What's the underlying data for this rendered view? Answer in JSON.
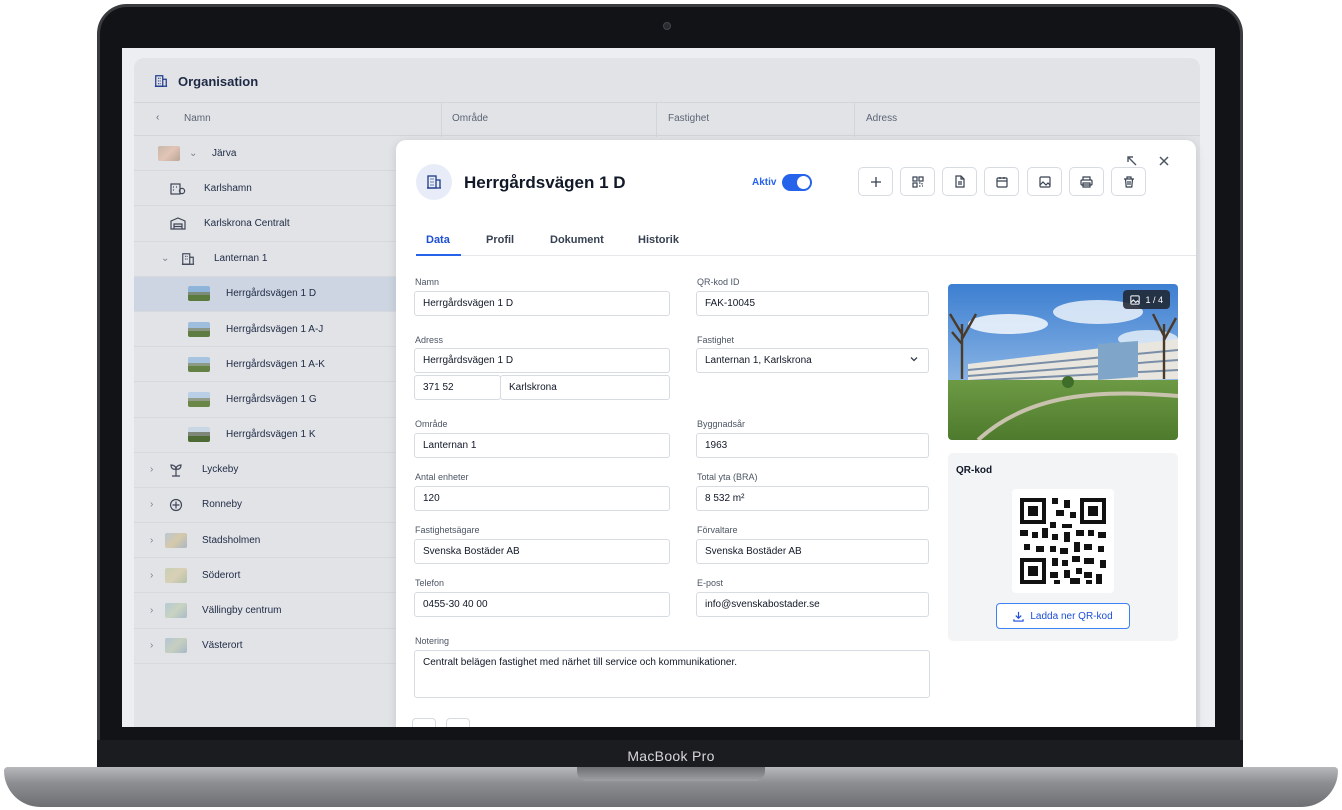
{
  "device": {
    "label": "MacBook Pro"
  },
  "app": {
    "section_title": "Organisation",
    "columns": [
      "Namn",
      "Område",
      "Fastighet",
      "Adress"
    ]
  },
  "tree": [
    {
      "label": "Järva",
      "level": 0,
      "expanded": true,
      "icon": "image-thumbnail"
    },
    {
      "label": "Karlshamn",
      "level": 1,
      "icon": "building-settings-icon"
    },
    {
      "label": "Karlskrona Centralt",
      "level": 1,
      "icon": "warehouse-icon"
    },
    {
      "label": "Lanternan 1",
      "level": 1,
      "expanded": true,
      "icon": "building-icon"
    },
    {
      "label": "Herrgårdsvägen 1 D",
      "level": 2,
      "selected": true,
      "icon": "image-thumbnail"
    },
    {
      "label": "Herrgårdsvägen 1 A-J",
      "level": 2,
      "icon": "image-thumbnail"
    },
    {
      "label": "Herrgårdsvägen 1 A-K",
      "level": 2,
      "icon": "image-thumbnail"
    },
    {
      "label": "Herrgårdsvägen 1 G",
      "level": 2,
      "icon": "image-thumbnail"
    },
    {
      "label": "Herrgårdsvägen 1 K",
      "level": 2,
      "icon": "image-thumbnail"
    },
    {
      "label": "Lyckeby",
      "level": 0,
      "icon": "plant-icon"
    },
    {
      "label": "Ronneby",
      "level": 0,
      "icon": "crosshair-icon"
    },
    {
      "label": "Stadsholmen",
      "level": 0,
      "icon": "image-thumbnail"
    },
    {
      "label": "Söderort",
      "level": 0,
      "icon": "image-thumbnail"
    },
    {
      "label": "Vällingby centrum",
      "level": 0,
      "icon": "image-thumbnail"
    },
    {
      "label": "Västerort",
      "level": 0,
      "icon": "image-thumbnail"
    }
  ],
  "detail": {
    "title": "Herrgårdsvägen 1 D",
    "status_label": "Aktiv",
    "status_on": true,
    "toolbar_icons": [
      "plus-icon",
      "qr-scan-icon",
      "document-icon",
      "calendar-icon",
      "image-icon",
      "print-icon",
      "trash-icon"
    ],
    "tabs": [
      "Data",
      "Profil",
      "Dokument",
      "Historik"
    ],
    "active_tab": "Data",
    "fields": {
      "namn_label": "Namn",
      "namn": "Herrgårdsvägen 1 D",
      "qr_label": "QR-kod ID",
      "qr": "FAK-10045",
      "adress_label": "Adress",
      "adress": "Herrgårdsvägen 1 D",
      "postnr": "371 52",
      "ort": "Karlskrona",
      "fastighet_label": "Fastighet",
      "fastighet": "Lanternan 1, Karlskrona",
      "omrade_label": "Område",
      "omrade": "Lanternan 1",
      "byggar_label": "Byggnadsår",
      "byggar": "1963",
      "enheter_label": "Antal enheter",
      "enheter": "120",
      "yta_label": "Total yta (BRA)",
      "yta": "8 532 m²",
      "agare_label": "Fastighetsägare",
      "agare": "Svenska Bostäder AB",
      "forvaltare_label": "Förvaltare",
      "forvaltare": "Svenska Bostäder AB",
      "telefon_label": "Telefon",
      "telefon": "0455-30 40 00",
      "epost_label": "E-post",
      "epost": "info@svenskabostader.se",
      "notering_label": "Notering",
      "notering": "Centralt belägen fastighet med närhet till service och kommunikationer."
    },
    "photo_counter": "1 / 4",
    "qr_section_title": "QR-kod",
    "qr_download_label": "Ladda ner QR-kod"
  }
}
